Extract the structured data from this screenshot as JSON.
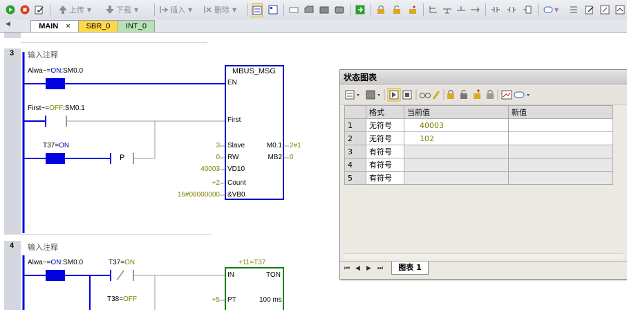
{
  "toolbar": {
    "upload": "上传",
    "download": "下载",
    "insert": "插入",
    "delete": "删除"
  },
  "tabs": [
    {
      "label": "MAIN",
      "color": "#ffffff"
    },
    {
      "label": "SBR_0",
      "color": "#ffd84a"
    },
    {
      "label": "INT_0",
      "color": "#b7e1b6"
    }
  ],
  "tab_close": "×",
  "network3": {
    "number": "3",
    "comment": "输入注释",
    "contact1": {
      "name": "Alwa~",
      "state": "ON",
      "addr": ":SM0.0"
    },
    "contact2": {
      "name": "First~",
      "state": "OFF",
      "addr": ":SM0.1"
    },
    "contact3": {
      "name": "T37",
      "state": "ON"
    },
    "p_contact": "P",
    "box": {
      "title": "MBUS_MSG",
      "en": "EN",
      "first": "First",
      "inputs": [
        {
          "pin": "Slave",
          "value": "3"
        },
        {
          "pin": "RW",
          "value": "0"
        },
        {
          "pin": "VD10",
          "value": "40003"
        },
        {
          "pin": "Count",
          "value": "+2"
        },
        {
          "pin": "&VB0",
          "value": "16#08000000"
        }
      ],
      "outputs": [
        {
          "pin": "M0.1",
          "value": "2#1"
        },
        {
          "pin": "MB2",
          "value": "0"
        }
      ]
    }
  },
  "network4": {
    "number": "4",
    "comment": "输入注释",
    "contact1": {
      "name": "Alwa~",
      "state": "ON",
      "addr": ":SM0.0"
    },
    "contact2": {
      "name": "T37",
      "state": "ON"
    },
    "contact3": {
      "name": "T38",
      "state": "OFF"
    },
    "timer": {
      "header": "+11=T37",
      "in": "IN",
      "type": "TON",
      "pt_value": "+5",
      "pt": "PT",
      "unit": "100 ms"
    }
  },
  "status_chart": {
    "title": "状态图表",
    "headers": [
      "格式",
      "当前值",
      "新值"
    ],
    "rows": [
      {
        "num": "1",
        "format": "无符号",
        "value": "40003",
        "new": ""
      },
      {
        "num": "2",
        "format": "无符号",
        "value": "102",
        "new": ""
      },
      {
        "num": "3",
        "format": "有符号",
        "value": "",
        "new": ""
      },
      {
        "num": "4",
        "format": "有符号",
        "value": "",
        "new": ""
      },
      {
        "num": "5",
        "format": "有符号",
        "value": "",
        "new": ""
      }
    ],
    "sheet_tab": "图表 1",
    "nav": {
      "first": "⏮",
      "prev": "◀",
      "next": "▶",
      "last": "⏭"
    }
  },
  "colors": {
    "energized": "#0000e0",
    "inactive": "#9a9a9a",
    "value_olive": "#808000",
    "box_border": "#0000c0",
    "timer_border": "#008000"
  }
}
